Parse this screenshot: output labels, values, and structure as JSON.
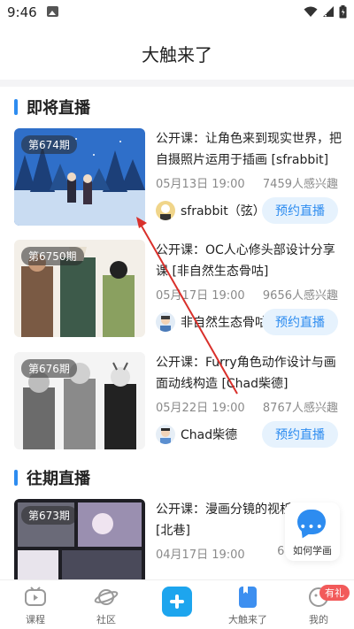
{
  "status_bar": {
    "time": "9:46"
  },
  "header": {
    "title": "大触来了"
  },
  "upcoming_section": {
    "title": "即将直播",
    "cards": [
      {
        "issue": "第674期",
        "title": "公开课：让角色来到现实世界，把自摄照片运用于插画 [sfrabbit]",
        "date": "05月13日 19:00",
        "interest": "7459人感兴趣",
        "author": "sfrabbit（弦）",
        "button": "预约直播"
      },
      {
        "issue": "第6750期",
        "title": "公开课：OC人心修头部设计分享课 [非自然生态骨咕]",
        "date": "05月17日 19:00",
        "interest": "9656人感兴趣",
        "author": "非自然生态骨咕",
        "button": "预约直播"
      },
      {
        "issue": "第676期",
        "title": "公开课：Furry角色动作设计与画面动线构造 [Chad柴德]",
        "date": "05月22日 19:00",
        "interest": "8767人感兴趣",
        "author": "Chad柴德",
        "button": "预约直播"
      }
    ]
  },
  "past_section": {
    "title": "往期直播",
    "cards": [
      {
        "issue": "第673期",
        "title": "公开课：漫画分镜的视析 [北巷]",
        "date": "04月17日 19:00",
        "interest": "644"
      }
    ]
  },
  "help_float": {
    "label": "如何学画",
    "icon": "chat-bubble-icon"
  },
  "tabbar": {
    "tabs": [
      {
        "label": "课程",
        "icon": "tv-play-icon"
      },
      {
        "label": "社区",
        "icon": "planet-icon"
      },
      {
        "label": "",
        "icon": "plus-icon"
      },
      {
        "label": "大触来了",
        "icon": "bookmark-card-icon"
      },
      {
        "label": "我的",
        "icon": "profile-icon"
      }
    ],
    "gift_badge": "有礼"
  },
  "colors": {
    "accent": "#2d8cf0",
    "button_bg": "#e6f2fd",
    "plus": "#1da5ee",
    "badge": "#f25a5a",
    "annotation_arrow": "#d9302b"
  }
}
